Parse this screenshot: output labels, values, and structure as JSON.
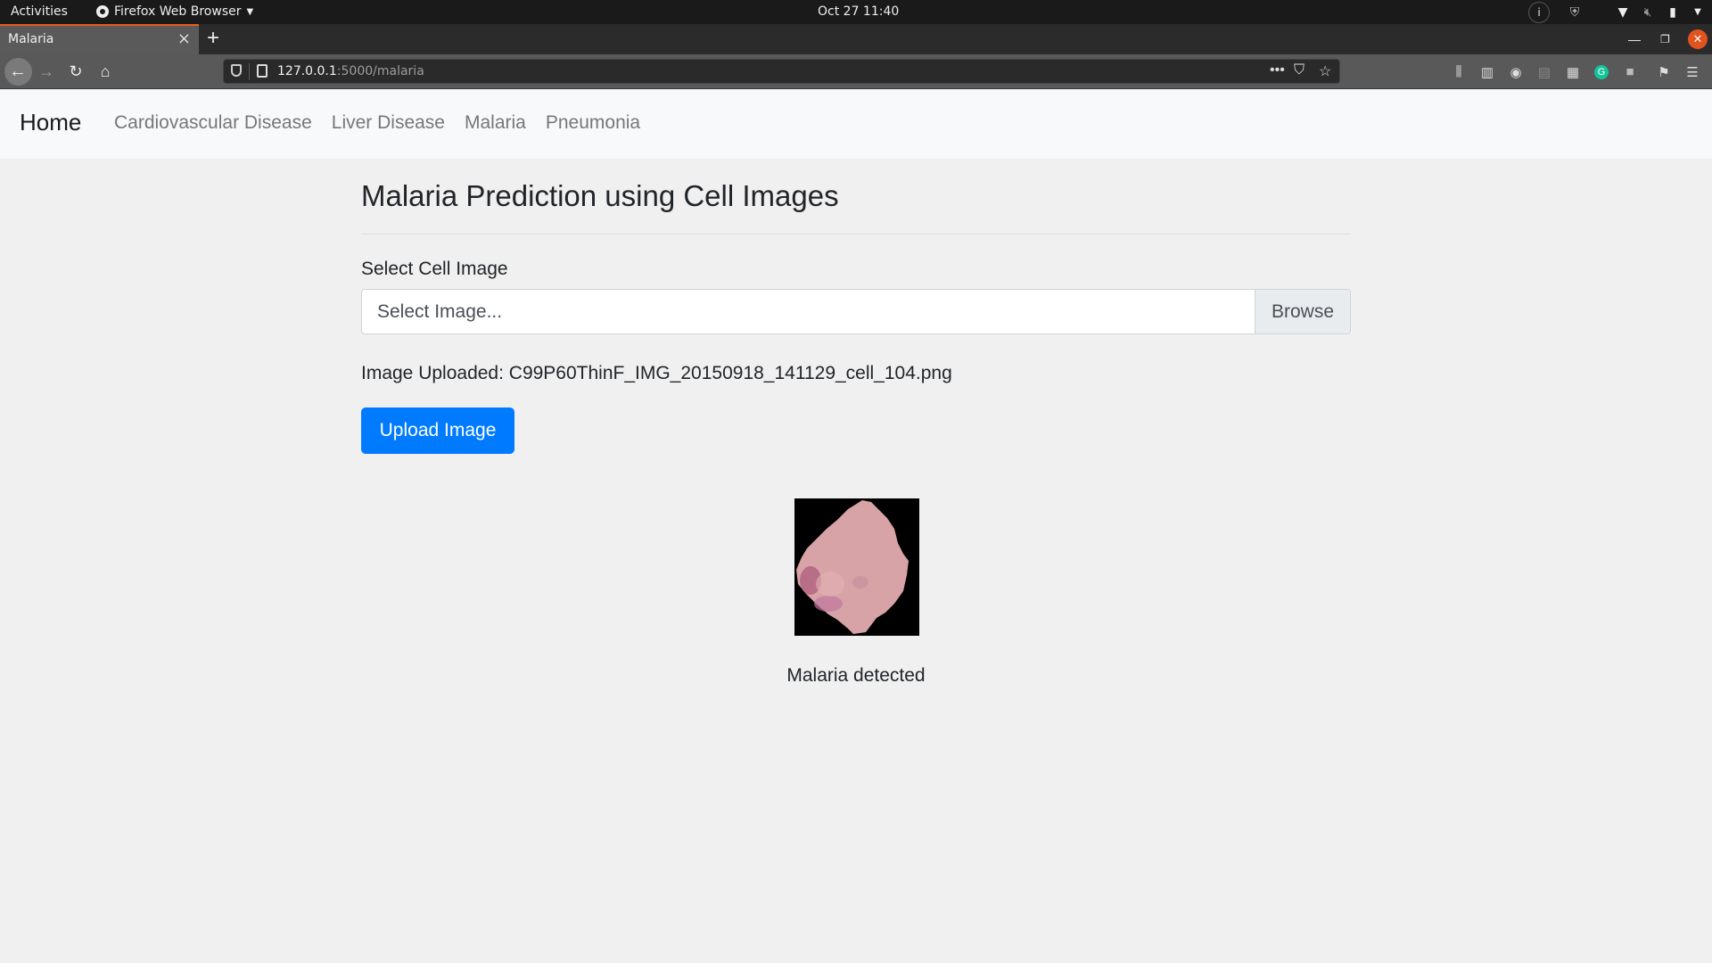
{
  "system_bar": {
    "activities": "Activities",
    "app_name": "Firefox Web Browser",
    "clock": "Oct 27  11:40",
    "tray_icons": [
      "info-icon",
      "shield-check-icon",
      "wifi-icon",
      "volume-muted-icon",
      "battery-icon",
      "system-menu-caret-icon"
    ]
  },
  "browser": {
    "tab_title": "Malaria",
    "url_host": "127.0.0.1",
    "url_rest": ":5000/malaria",
    "toolbar_icons": [
      "library-icon",
      "sidebar-icon",
      "account-icon",
      "clipboard-icon",
      "fence-extension-icon",
      "grammarly-icon",
      "touch-extension-icon",
      "gift-icon",
      "hamburger-menu-icon"
    ]
  },
  "navbar": {
    "brand": "Home",
    "links": [
      {
        "label": "Cardiovascular Disease"
      },
      {
        "label": "Liver Disease"
      },
      {
        "label": "Malaria"
      },
      {
        "label": "Pneumonia"
      }
    ]
  },
  "main": {
    "title": "Malaria Prediction using Cell Images",
    "field_label": "Select Cell Image",
    "file_placeholder": "Select Image...",
    "browse_label": "Browse",
    "uploaded_text": "Image Uploaded: C99P60ThinF_IMG_20150918_141129_cell_104.png",
    "upload_button": "Upload Image",
    "result_text": "Malaria detected",
    "accent_color": "#007bff"
  }
}
